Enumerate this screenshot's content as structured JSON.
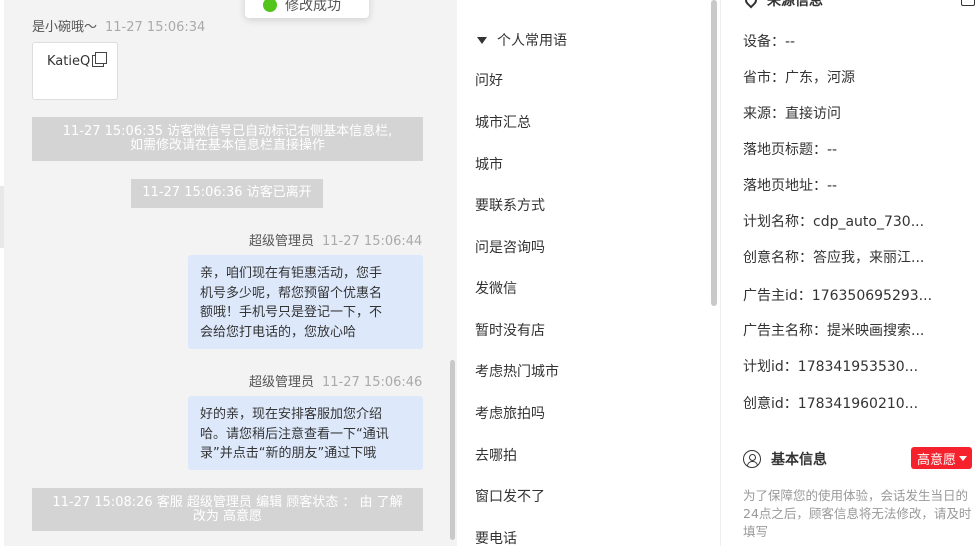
{
  "toast": {
    "text": "修改成功"
  },
  "chat": {
    "visitor_message": {
      "sender": "是小碗哦～",
      "time": "11-27 15:06:34",
      "card_text": "KatieQ"
    },
    "system_messages": [
      {
        "line1": "11-27 15:06:35 访客微信号已自动标记右侧基本信息栏,",
        "line2": "如需修改请在基本信息栏直接操作"
      },
      {
        "line1": "11-27 15:06:36 访客已离开",
        "line2": ""
      },
      {
        "line1": "11-27 15:08:26 客服 超级管理员 编辑 顾客状态 ： 由 了解",
        "line2": "改为 高意愿"
      }
    ],
    "agent_messages": [
      {
        "sender": "超级管理员",
        "time": "11-27 15:06:44",
        "lines": [
          "亲，咱们现在有钜惠活动，您手",
          "机号多少呢，帮您预留个优惠名",
          "额哦！手机号只是登记一下，不",
          "会给您打电话的，您放心哈"
        ]
      },
      {
        "sender": "超级管理员",
        "time": "11-27 15:06:46",
        "lines": [
          "好的亲，现在安排客服加您介绍",
          "哈。请您稍后注意查看一下“通讯",
          "录”并点击“新的朋友”通过下哦"
        ]
      }
    ]
  },
  "phrases": {
    "header": "个人常用语",
    "items": [
      "问好",
      "城市汇总",
      "城市",
      "要联系方式",
      "问是咨询吗",
      "发微信",
      "暂时没有店",
      "考虑热门城市",
      "考虑旅拍吗",
      "去哪拍",
      "窗口发不了",
      "要电话"
    ]
  },
  "info": {
    "source_title": "来源信息",
    "rows": [
      {
        "label": "设备：",
        "value": "--"
      },
      {
        "label": "省市：",
        "value": "广东，河源"
      },
      {
        "label": "来源：",
        "value": "直接访问"
      },
      {
        "label": "落地页标题：",
        "value": "--"
      },
      {
        "label": "落地页地址：",
        "value": "--"
      },
      {
        "label": "计划名称：",
        "value": "cdp_auto_730..."
      },
      {
        "label": "创意名称：",
        "value": "答应我，来丽江..."
      },
      {
        "label": "广告主id：",
        "value": "176350695293..."
      },
      {
        "label": "广告主名称：",
        "value": "提米映画搜索..."
      },
      {
        "label": "计划id：",
        "value": "178341953530..."
      },
      {
        "label": "创意id：",
        "value": "178341960210..."
      }
    ],
    "basic_title": "基本信息",
    "intent_badge": "高意愿",
    "note": "为了保障您的使用体验，会话发生当日的24点之后，顾客信息将无法修改，请及时填写"
  },
  "colors": {
    "accent_red": "#f5222d",
    "bubble_blue": "#dde9fb",
    "system_gray": "#d4d4d4",
    "success_green": "#52c41a"
  }
}
